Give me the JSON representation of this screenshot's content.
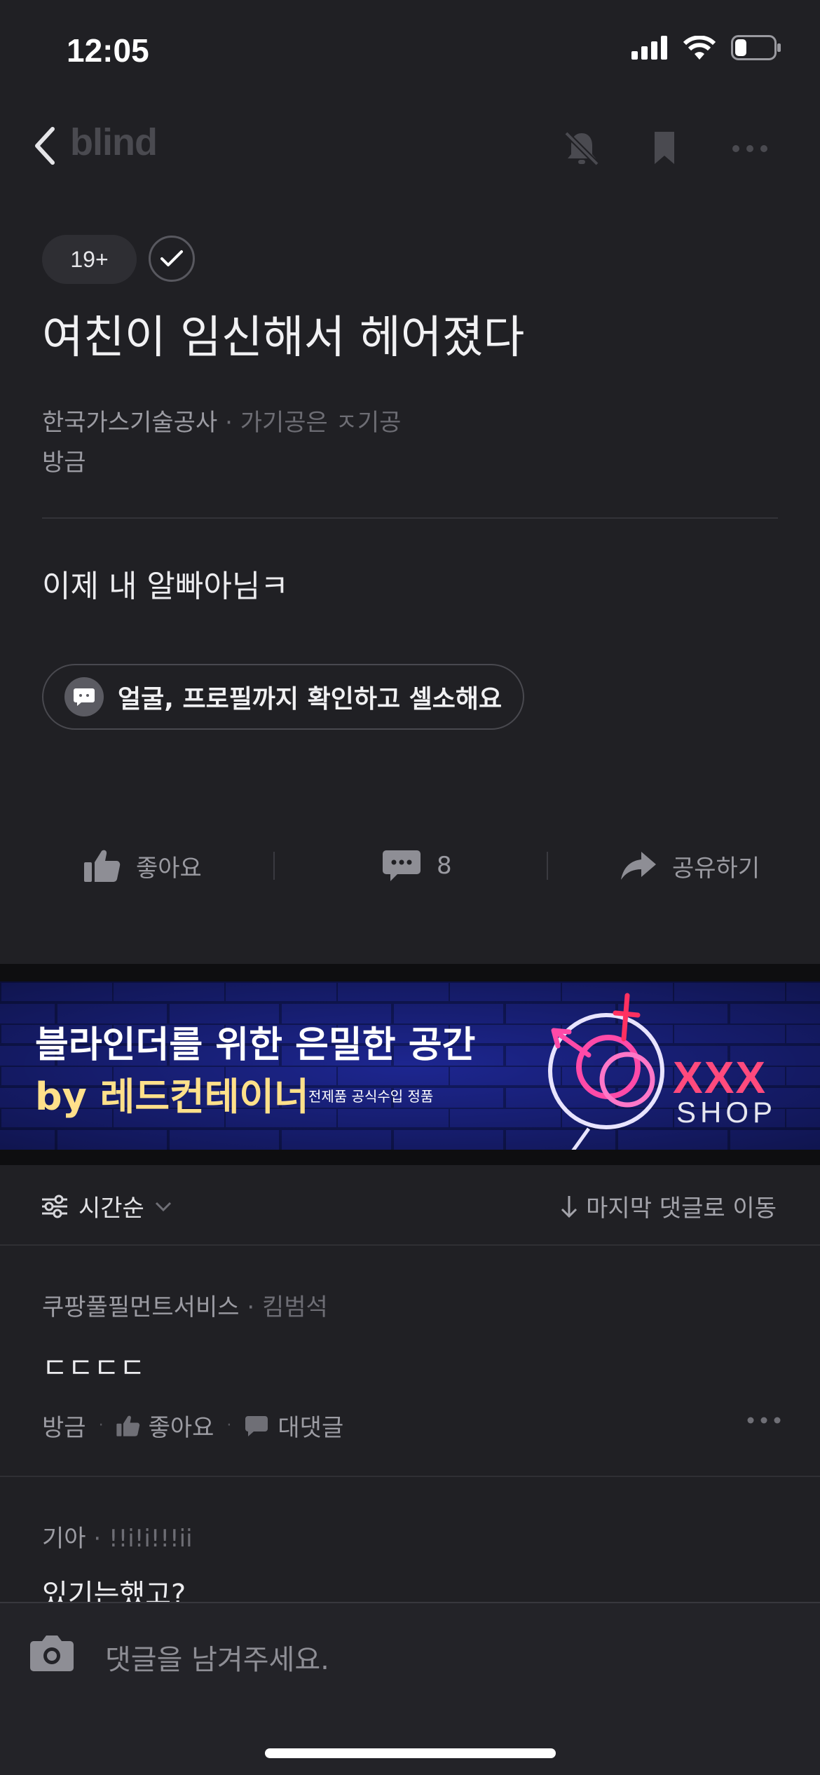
{
  "status": {
    "time": "12:05",
    "battery_level": 0.3
  },
  "nav": {
    "brand": "blind",
    "icons": [
      "bell-off-icon",
      "bookmark-icon",
      "more-horizontal-icon"
    ]
  },
  "post": {
    "badge": "19+",
    "title": "여친이 임신해서 헤어졌다",
    "company": "한국가스기술공사",
    "nickname": "가기공은 ㅈ기공",
    "time": "방금",
    "body": "이제 내 알빠아님ㅋ",
    "promo": "얼굴, 프로필까지 확인하고 셀소해요"
  },
  "actions": {
    "like": "좋아요",
    "comments": "8",
    "share": "공유하기"
  },
  "banner": {
    "line1": "블라인더를 위한 은밀한 공간",
    "line2": "by 레드컨테이너",
    "sub": "전제품 공식수입 정품",
    "xxx": "XXX",
    "shop": "SHOP"
  },
  "sort": {
    "order": "시간순",
    "jump": "마지막 댓글로 이동"
  },
  "comments": [
    {
      "company": "쿠팡풀필먼트서비스",
      "nickname": "킴범석",
      "text": "ㄷㄷㄷㄷ",
      "time": "방금",
      "like": "좋아요",
      "reply": "대댓글"
    },
    {
      "company": "기아",
      "nickname": "!!i!i!!!ii",
      "text": "있기는했고?"
    }
  ],
  "input": {
    "placeholder": "댓글을 남겨주세요."
  },
  "colors": {
    "background": "#202024",
    "banner_pink": "#ff4a7d",
    "banner_yellow": "#ffe08a"
  }
}
